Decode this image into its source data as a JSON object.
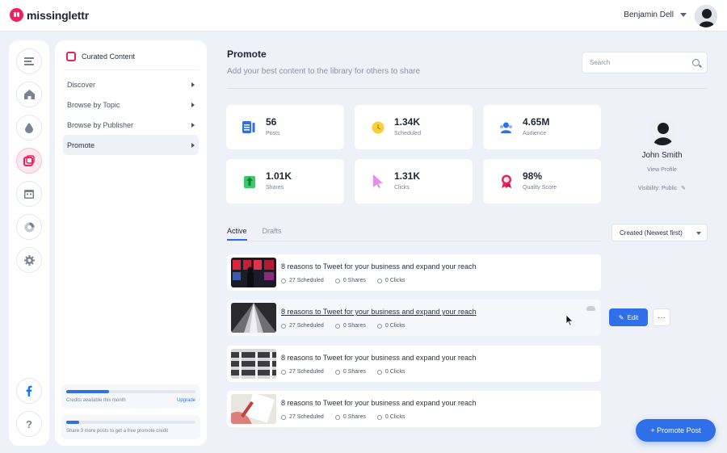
{
  "app": {
    "brand": "missinglettr",
    "brand_color": "#e8245e",
    "accent": "#2f6fe8"
  },
  "topbar": {
    "user_name": "Benjamin Dell"
  },
  "rail": {
    "icons": [
      "menu-icon",
      "home-icon",
      "drop-icon",
      "curated-content-icon",
      "calendar-icon",
      "analytics-icon",
      "settings-icon",
      "facebook-icon",
      "help-icon"
    ]
  },
  "submenu": {
    "title": "Curated Content",
    "items": [
      {
        "label": "Discover"
      },
      {
        "label": "Browse by Topic"
      },
      {
        "label": "Browse by Publisher"
      },
      {
        "label": "Promote"
      }
    ],
    "active_index": 3,
    "credits": {
      "label": "Credits available this month",
      "action": "Upgrade",
      "progress": 0.33
    },
    "share_hint": {
      "label": "Share 3 more posts to get a free promote credit",
      "progress": 0.1
    }
  },
  "main": {
    "title": "Promote",
    "subtitle": "Add your best content to the library for others to share",
    "search_placeholder": "Search"
  },
  "stats": [
    {
      "value": "56",
      "label": "Posts",
      "icon": "list-icon",
      "color": "#2f6fe8"
    },
    {
      "value": "1.34K",
      "label": "Scheduled",
      "icon": "clock-icon",
      "color": "#f7cf3d"
    },
    {
      "value": "4.65M",
      "label": "Audience",
      "icon": "users-icon",
      "color": "#2f6fe8"
    },
    {
      "value": "1.01K",
      "label": "Shares",
      "icon": "arrow-up-icon",
      "color": "#3cc96b"
    },
    {
      "value": "1.31K",
      "label": "Clicks",
      "icon": "cursor-icon",
      "color": "#e58ee8"
    },
    {
      "value": "98%",
      "label": "Quality Score",
      "icon": "badge-icon",
      "color": "#e8245e"
    }
  ],
  "profile": {
    "name": "John Smith",
    "view_link": "View Profile",
    "visibility": "Visibility: Public"
  },
  "tabs": [
    {
      "label": "Active"
    },
    {
      "label": "Drafts"
    }
  ],
  "sort": {
    "selected": "Created (Newest first)"
  },
  "posts": [
    {
      "title": "8 reasons to Tweet for your business and expand your reach",
      "scheduled": "27 Scheduled",
      "shares": "0 Shares",
      "clicks": "0 Clicks"
    },
    {
      "title": "8 reasons to Tweet for your business and expand your reach",
      "scheduled": "27 Scheduled",
      "shares": "0 Shares",
      "clicks": "0 Clicks"
    },
    {
      "title": "8 reasons to Tweet for your business and expand your reach",
      "scheduled": "27 Scheduled",
      "shares": "0 Shares",
      "clicks": "0 Clicks"
    },
    {
      "title": "8 reasons to Tweet for your business and expand your reach",
      "scheduled": "27 Scheduled",
      "shares": "0 Shares",
      "clicks": "0 Clicks"
    }
  ],
  "actions": {
    "edit": "Edit",
    "more": "···",
    "promote_post": "+ Promote Post"
  }
}
